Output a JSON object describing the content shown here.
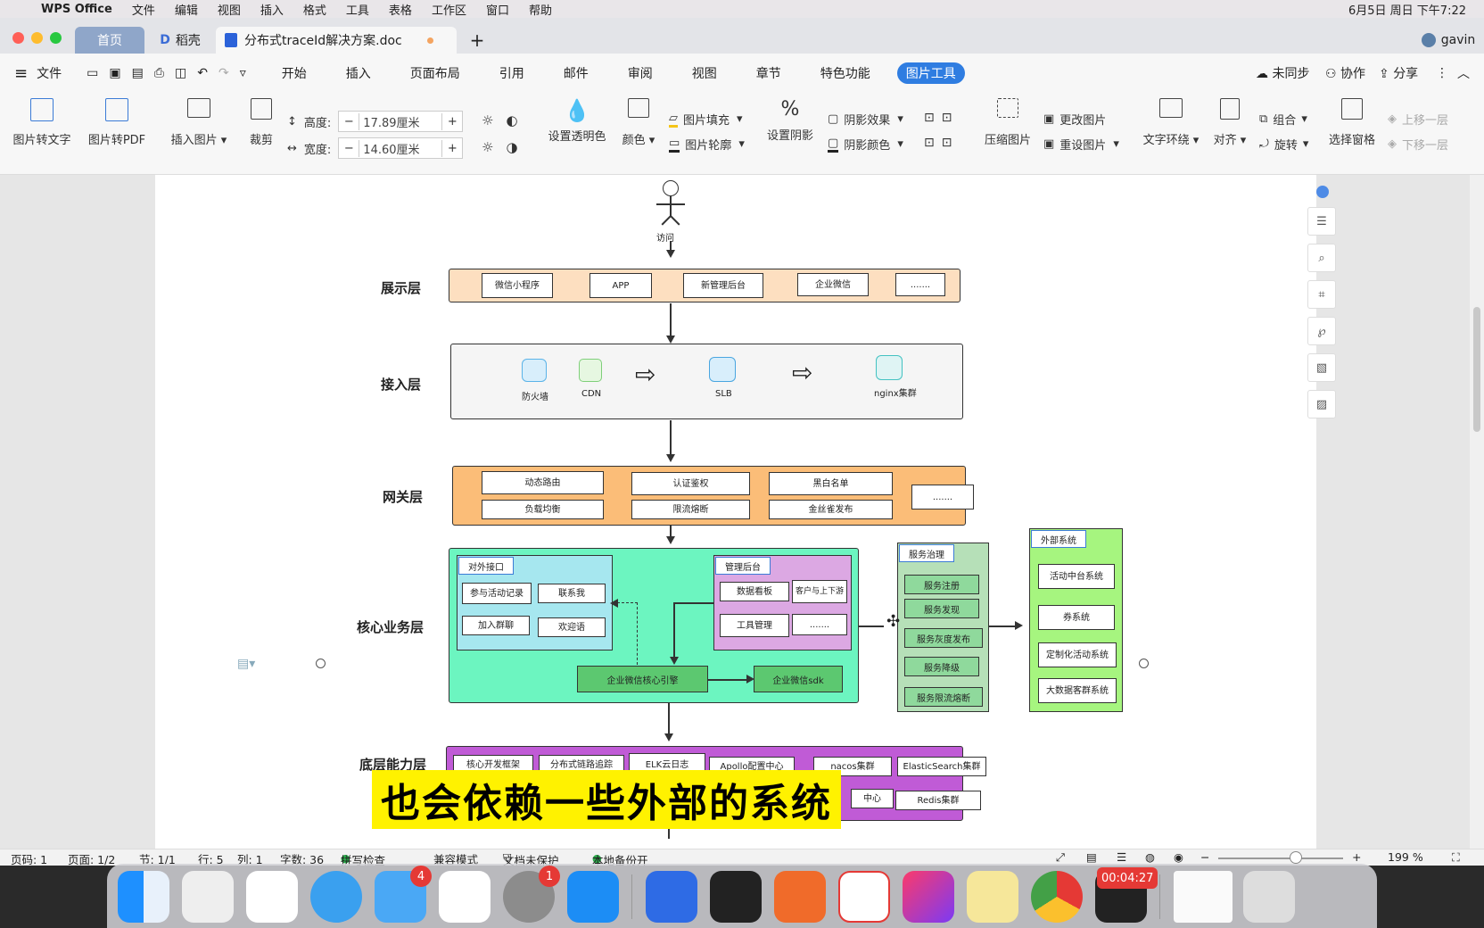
{
  "menubar": {
    "app": "WPS Office",
    "items": [
      "文件",
      "编辑",
      "视图",
      "插入",
      "格式",
      "工具",
      "表格",
      "工作区",
      "窗口",
      "帮助"
    ],
    "clock": "6月5日 周日 下午7:22"
  },
  "tabs": {
    "home": "首页",
    "daoke": "稻壳",
    "doc": "分布式traceId解决方案.doc",
    "user": "gavin"
  },
  "menurow": {
    "file": "文件",
    "items": [
      "开始",
      "插入",
      "页面布局",
      "引用",
      "邮件",
      "审阅",
      "视图",
      "章节",
      "特色功能",
      "图片工具"
    ],
    "active": "图片工具",
    "sync": "未同步",
    "collab": "协作",
    "share": "分享"
  },
  "toolbar": {
    "pic2text": "图片转文字",
    "pic2pdf": "图片转PDF",
    "insert_pic": "插入图片",
    "crop": "裁剪",
    "height_label": "高度:",
    "height_value": "17.89厘米",
    "width_label": "宽度:",
    "width_value": "14.60厘米",
    "transparent": "设置透明色",
    "color": "颜色",
    "fill": "图片填充",
    "outline": "图片轮廓",
    "shadow_set": "设置阴影",
    "shadow_effect": "阴影效果",
    "shadow_color": "阴影颜色",
    "compress": "压缩图片",
    "change_pic": "更改图片",
    "reset_pic": "重设图片",
    "wrap": "文字环绕",
    "align": "对齐",
    "group": "组合",
    "rotate": "旋转",
    "select_pane": "选择窗格",
    "up": "上移一层",
    "down": "下移一层"
  },
  "diagram": {
    "actor": "访问",
    "display": {
      "label": "展示层",
      "items": [
        "微信小程序",
        "APP",
        "新管理后台",
        "企业微信",
        "......."
      ]
    },
    "access": {
      "label": "接入层",
      "items": [
        "防火墙",
        "CDN",
        "SLB",
        "nginx集群"
      ]
    },
    "gateway": {
      "label": "网关层",
      "items": [
        "动态路由",
        "认证鉴权",
        "黑白名单",
        "负载均衡",
        "限流熔断",
        "金丝雀发布",
        "......."
      ]
    },
    "core": {
      "label": "核心业务层",
      "ext_title": "对外接口",
      "ext_items": [
        "参与活动记录",
        "联系我",
        "加入群聊",
        "欢迎语"
      ],
      "mgmt_title": "管理后台",
      "mgmt_items": [
        "数据看板",
        "客户与上下游",
        "工具管理",
        "......."
      ],
      "engine": "企业微信核心引擎",
      "sdk": "企业微信sdk"
    },
    "governance": {
      "title": "服务治理",
      "items": [
        "服务注册",
        "服务发现",
        "服务灰度发布",
        "服务降级",
        "服务限流熔断"
      ]
    },
    "external": {
      "title": "外部系统",
      "items": [
        "活动中台系统",
        "券系统",
        "定制化活动系统",
        "大数据客群系统"
      ]
    },
    "base": {
      "label": "底层能力层",
      "items": [
        "核心开发框架",
        "分布式链路追踪",
        "ELK云日志",
        "Apollo配置中心",
        "nacos集群",
        "ElasticSearch集群",
        "中心",
        "Redis集群"
      ]
    }
  },
  "statusbar": {
    "page_code": "页码: 1",
    "pages": "页面: 1/2",
    "section": "节: 1/1",
    "row": "行: 5",
    "col": "列: 1",
    "words": "字数: 36",
    "spell": "拼写检查",
    "compat": "兼容模式",
    "protect": "文档未保护",
    "backup": "本地备份开",
    "zoom": "199 %"
  },
  "subtitle": "也会依赖一些外部的系统",
  "dock": {
    "mail_badge": "4",
    "settings_badge": "1",
    "timer": "00:04:27"
  }
}
